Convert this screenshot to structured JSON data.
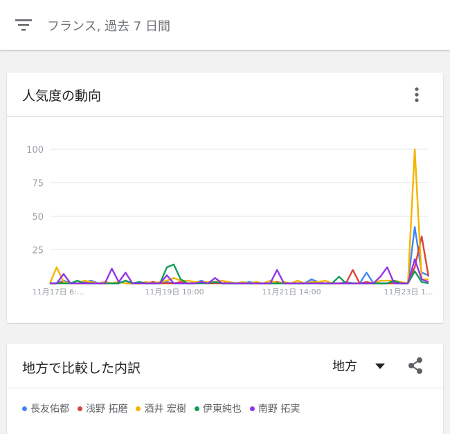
{
  "topbar": {
    "filter_text": "フランス, 過去 7 日間"
  },
  "interest_card": {
    "title": "人気度の動向"
  },
  "chart_data": {
    "type": "line",
    "title": "",
    "xlabel": "",
    "ylabel": "",
    "ylim": [
      0,
      100
    ],
    "yticks": [
      25,
      50,
      75,
      100
    ],
    "x_tick_labels": [
      "11月17日 6:...",
      "11月19日 10:00",
      "11月21日 14:00",
      "11月23日 1..."
    ],
    "grid": true,
    "n_points": 56,
    "series": [
      {
        "name": "長友佑都",
        "color": "#4285f4",
        "values": [
          0,
          0,
          2,
          0,
          0,
          1,
          2,
          0,
          1,
          0,
          0,
          2,
          0,
          1,
          0,
          0,
          0,
          1,
          0,
          0,
          0,
          0,
          2,
          0,
          1,
          0,
          0,
          0,
          0,
          1,
          0,
          0,
          0,
          0,
          0,
          0,
          0,
          0,
          3,
          1,
          0,
          0,
          0,
          1,
          0,
          0,
          8,
          0,
          0,
          0,
          1,
          0,
          0,
          42,
          8,
          6
        ]
      },
      {
        "name": "浅野 拓磨",
        "color": "#db4437",
        "values": [
          0,
          0,
          1,
          0,
          0,
          0,
          1,
          0,
          0,
          0,
          1,
          0,
          0,
          0,
          0,
          1,
          0,
          0,
          0,
          1,
          0,
          0,
          1,
          0,
          0,
          0,
          1,
          0,
          0,
          0,
          0,
          0,
          0,
          1,
          0,
          0,
          0,
          0,
          1,
          0,
          0,
          0,
          0,
          0,
          10,
          0,
          1,
          0,
          0,
          0,
          0,
          0,
          0,
          12,
          35,
          5
        ]
      },
      {
        "name": "酒井 宏樹",
        "color": "#f4b400",
        "values": [
          0,
          12,
          1,
          0,
          0,
          2,
          1,
          0,
          1,
          0,
          1,
          0,
          0,
          0,
          1,
          0,
          1,
          2,
          4,
          2,
          2,
          1,
          1,
          1,
          1,
          2,
          1,
          0,
          1,
          0,
          1,
          0,
          2,
          0,
          1,
          0,
          2,
          0,
          1,
          1,
          2,
          0,
          0,
          0,
          0,
          0,
          0,
          0,
          2,
          2,
          2,
          1,
          0,
          100,
          3,
          3
        ]
      },
      {
        "name": "伊東純也",
        "color": "#0f9d58",
        "values": [
          0,
          0,
          0,
          0,
          2,
          0,
          0,
          0,
          0,
          0,
          0,
          2,
          0,
          1,
          0,
          0,
          0,
          12,
          14,
          3,
          0,
          0,
          0,
          0,
          1,
          0,
          0,
          0,
          0,
          0,
          0,
          0,
          0,
          0,
          0,
          0,
          0,
          0,
          0,
          0,
          0,
          0,
          5,
          0,
          0,
          0,
          0,
          0,
          0,
          0,
          2,
          0,
          0,
          9,
          1,
          0
        ]
      },
      {
        "name": "南野 拓実",
        "color": "#9334e6",
        "values": [
          0,
          0,
          7,
          0,
          0,
          0,
          0,
          0,
          0,
          11,
          1,
          8,
          0,
          0,
          0,
          0,
          0,
          6,
          0,
          0,
          0,
          0,
          1,
          0,
          4,
          0,
          0,
          0,
          0,
          0,
          0,
          0,
          0,
          10,
          0,
          0,
          0,
          0,
          0,
          0,
          0,
          0,
          0,
          0,
          0,
          0,
          0,
          0,
          5,
          12,
          0,
          0,
          0,
          18,
          3,
          1
        ]
      }
    ]
  },
  "region_card": {
    "title": "地方で比較した内訳",
    "region_select": "地方"
  },
  "icons": {
    "filter": "filter-icon",
    "more": "more-vertical-icon",
    "dropdown": "dropdown-arrow-icon",
    "share": "share-icon"
  }
}
